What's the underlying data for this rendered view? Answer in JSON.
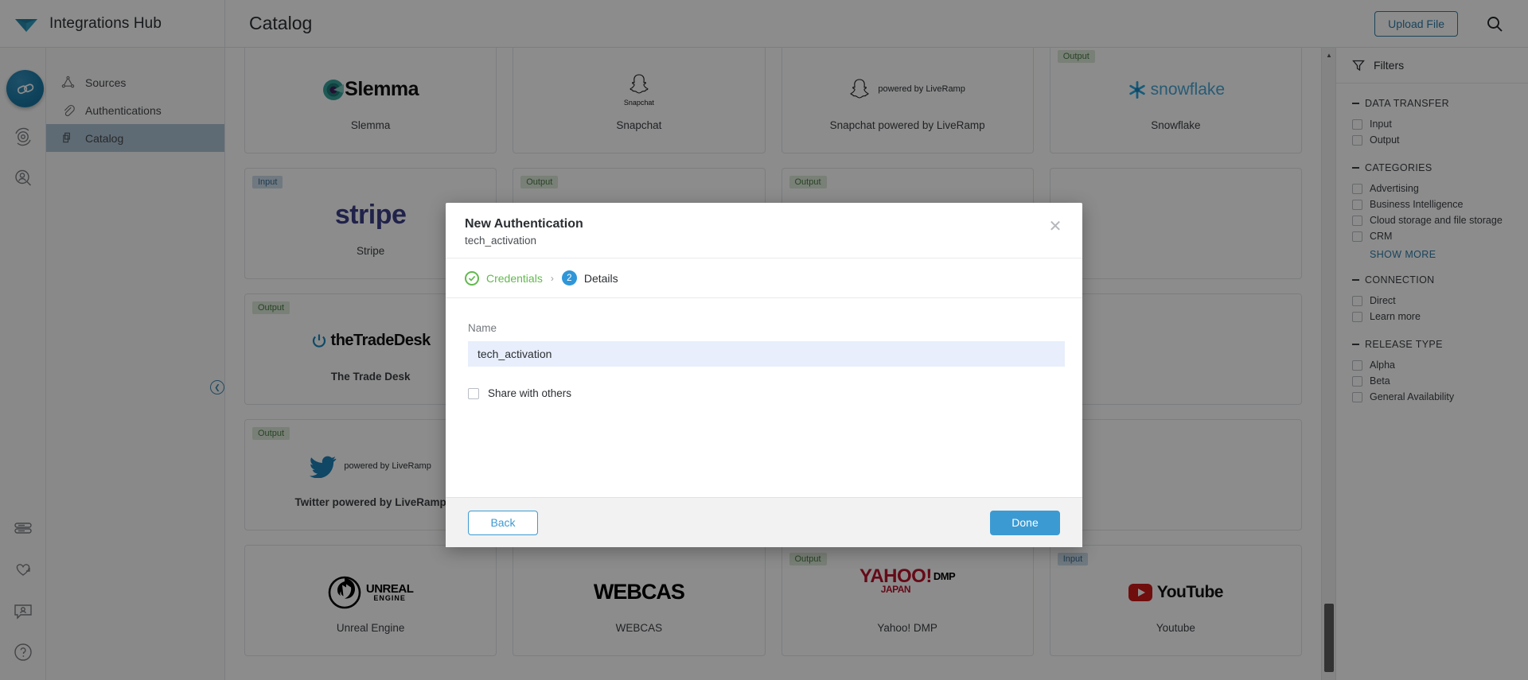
{
  "app": {
    "brand": "Integrations Hub",
    "page_title": "Catalog",
    "logo_icon": "diamond-logo",
    "accent_blue": "#3c9ad2",
    "accent_green": "#62b94e"
  },
  "topbar": {
    "upload_label": "Upload File",
    "search_icon": "search-icon"
  },
  "rail": {
    "items": [
      {
        "icon": "link-chain-icon",
        "active": true
      },
      {
        "icon": "gear-sync-icon",
        "active": false
      },
      {
        "icon": "user-search-icon",
        "active": false
      },
      {
        "icon": "list-lines-icon",
        "active": false
      },
      {
        "icon": "heart-arrow-icon",
        "active": false
      },
      {
        "icon": "user-chat-icon",
        "active": false
      },
      {
        "icon": "help-circle-icon",
        "active": false
      }
    ]
  },
  "nav": {
    "items": [
      {
        "label": "Sources",
        "icon": "triangle-nodes-icon",
        "active": false
      },
      {
        "label": "Authentications",
        "icon": "paperclip-icon",
        "active": false
      },
      {
        "label": "Catalog",
        "icon": "copy-pages-icon",
        "active": true
      }
    ],
    "collapse_icon": "chevron-left-icon"
  },
  "catalog": {
    "cards": [
      {
        "name": "Slemma",
        "badge": "",
        "logo_kind": "slemma"
      },
      {
        "name": "Snapchat",
        "badge": "",
        "logo_kind": "snapchat",
        "logo_caption": "Snapchat"
      },
      {
        "name": "Snapchat powered by LiveRamp",
        "badge": "",
        "logo_kind": "snapchat-liveramp",
        "logo_caption": "powered by LiveRamp"
      },
      {
        "name": "Snowflake",
        "badge": "Output",
        "logo_kind": "snowflake"
      },
      {
        "name": "Stripe",
        "badge": "Input",
        "logo_kind": "stripe"
      },
      {
        "name": "",
        "badge": "Output",
        "logo_kind": ""
      },
      {
        "name": "",
        "badge": "Output",
        "logo_kind": ""
      },
      {
        "name": "",
        "badge": "",
        "logo_kind": ""
      },
      {
        "name": "The Trade Desk",
        "badge": "Output",
        "logo_kind": "tradedesk"
      },
      {
        "name": "",
        "badge": "",
        "logo_kind": ""
      },
      {
        "name": "",
        "badge": "",
        "logo_kind": ""
      },
      {
        "name": "",
        "badge": "",
        "logo_kind": ""
      },
      {
        "name": "Twitter powered by LiveRamp",
        "badge": "Output",
        "logo_kind": "twitter-liveramp",
        "logo_caption": "powered by LiveRamp"
      },
      {
        "name": "",
        "badge": "",
        "logo_kind": ""
      },
      {
        "name": "",
        "badge": "",
        "logo_kind": ""
      },
      {
        "name": "",
        "badge": "",
        "logo_kind": ""
      },
      {
        "name": "Unreal Engine",
        "badge": "",
        "logo_kind": "unreal"
      },
      {
        "name": "WEBCAS",
        "badge": "",
        "logo_kind": "webcas"
      },
      {
        "name": "Yahoo! DMP",
        "badge": "Output",
        "logo_kind": "yahoo"
      },
      {
        "name": "Youtube",
        "badge": "Input",
        "logo_kind": "youtube"
      }
    ]
  },
  "filters": {
    "title": "Filters",
    "icon": "funnel-icon",
    "groups": [
      {
        "title": "DATA TRANSFER",
        "options": [
          {
            "label": "Input",
            "checked": false
          },
          {
            "label": "Output",
            "checked": false
          }
        ]
      },
      {
        "title": "CATEGORIES",
        "options": [
          {
            "label": "Advertising",
            "checked": false
          },
          {
            "label": "Business Intelligence",
            "checked": false
          },
          {
            "label": "Cloud storage and file storage",
            "checked": false
          },
          {
            "label": "CRM",
            "checked": false
          }
        ],
        "show_more": "SHOW MORE"
      },
      {
        "title": "CONNECTION",
        "options": [
          {
            "label": "Direct",
            "checked": false
          },
          {
            "label": "Learn more",
            "checked": false
          }
        ]
      },
      {
        "title": "RELEASE TYPE",
        "options": [
          {
            "label": "Alpha",
            "checked": false
          },
          {
            "label": "Beta",
            "checked": false
          },
          {
            "label": "General Availability",
            "checked": false
          }
        ]
      }
    ]
  },
  "modal": {
    "title": "New Authentication",
    "subtitle": "tech_activation",
    "close_icon": "close-icon",
    "steps": {
      "completed": {
        "label": "Credentials",
        "icon": "check-circle-icon"
      },
      "separator": "›",
      "current": {
        "number": "2",
        "label": "Details"
      }
    },
    "name_field": {
      "label": "Name",
      "value": "tech_activation",
      "placeholder": "Name"
    },
    "share_checkbox": {
      "label": "Share with others",
      "checked": false
    },
    "footer": {
      "back_label": "Back",
      "done_label": "Done"
    }
  }
}
